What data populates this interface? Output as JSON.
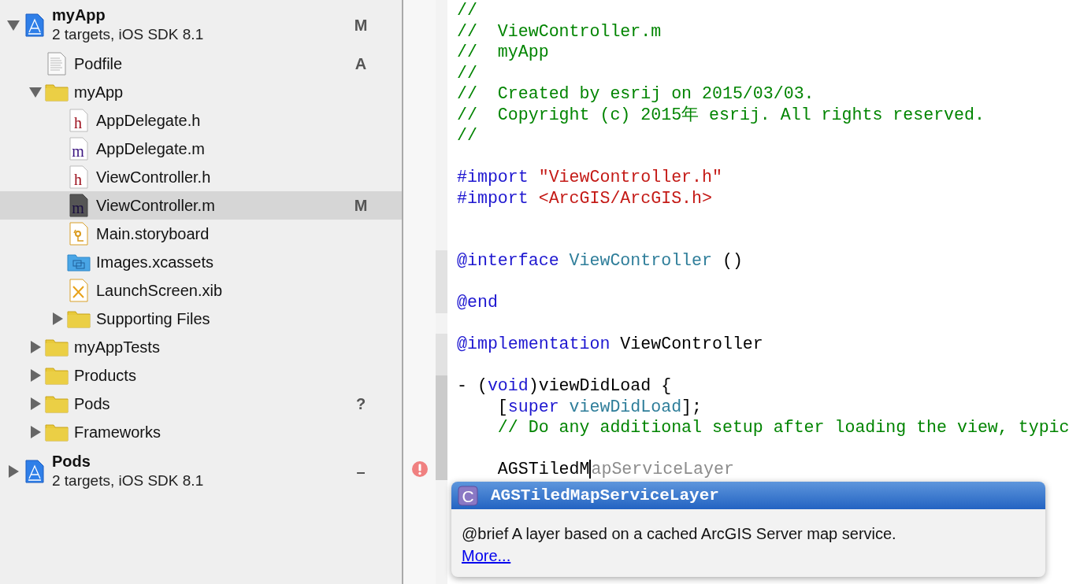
{
  "navigator": {
    "items": [
      {
        "name": "myApp",
        "kind": "project",
        "subtitle": "2 targets, iOS SDK 8.1",
        "badge": "M",
        "expanded": true,
        "selected": false,
        "children": [
          {
            "name": "Podfile",
            "kind": "text",
            "badge": "A",
            "selected": false
          },
          {
            "name": "myApp",
            "kind": "folder",
            "expanded": true,
            "selected": false,
            "children": [
              {
                "name": "AppDelegate.h",
                "kind": "header",
                "glyph": "h",
                "selected": false
              },
              {
                "name": "AppDelegate.m",
                "kind": "source",
                "glyph": "m",
                "selected": false
              },
              {
                "name": "ViewController.h",
                "kind": "header",
                "glyph": "h",
                "selected": false
              },
              {
                "name": "ViewController.m",
                "kind": "source",
                "glyph": "m",
                "badge": "M",
                "selected": true
              },
              {
                "name": "Main.storyboard",
                "kind": "storyboard",
                "selected": false
              },
              {
                "name": "Images.xcassets",
                "kind": "assets",
                "selected": false
              },
              {
                "name": "LaunchScreen.xib",
                "kind": "xib",
                "selected": false
              },
              {
                "name": "Supporting Files",
                "kind": "folder",
                "expanded": false,
                "selected": false
              }
            ]
          },
          {
            "name": "myAppTests",
            "kind": "folder",
            "expanded": false,
            "selected": false
          },
          {
            "name": "Products",
            "kind": "folder",
            "expanded": false,
            "selected": false
          },
          {
            "name": "Pods",
            "kind": "folder",
            "badge": "?",
            "expanded": false,
            "selected": false
          },
          {
            "name": "Frameworks",
            "kind": "folder",
            "expanded": false,
            "selected": false
          }
        ]
      },
      {
        "name": "Pods",
        "kind": "project",
        "subtitle": "2 targets, iOS SDK 8.1",
        "badge": "–",
        "expanded": false,
        "selected": false
      }
    ]
  },
  "editor": {
    "blocks": [
      {
        "kind": "unchanged",
        "lines": [
          {
            "kind": "code",
            "tokens": [
              {
                "kind": "comment",
                "text": "//"
              }
            ]
          },
          {
            "kind": "code",
            "tokens": [
              {
                "kind": "comment",
                "text": "//  ViewController.m"
              }
            ]
          },
          {
            "kind": "code",
            "tokens": [
              {
                "kind": "comment",
                "text": "//  myApp"
              }
            ]
          },
          {
            "kind": "code",
            "tokens": [
              {
                "kind": "comment",
                "text": "//"
              }
            ]
          },
          {
            "kind": "code",
            "tokens": [
              {
                "kind": "comment",
                "text": "//  Created by esrij on 2015/03/03."
              }
            ]
          },
          {
            "kind": "code",
            "tokens": [
              {
                "kind": "comment",
                "text": "//  Copyright (c) 2015年 esrij. All rights reserved."
              }
            ]
          },
          {
            "kind": "code",
            "tokens": [
              {
                "kind": "comment",
                "text": "//"
              }
            ]
          },
          {
            "kind": "blank"
          },
          {
            "kind": "code",
            "tokens": [
              {
                "kind": "keyword",
                "text": "#import "
              },
              {
                "kind": "string",
                "text": "\"ViewController.h\""
              }
            ]
          },
          {
            "kind": "code",
            "tokens": [
              {
                "kind": "keyword",
                "text": "#import "
              },
              {
                "kind": "string",
                "text": "<ArcGIS/ArcGIS.h>"
              }
            ]
          },
          {
            "kind": "blank"
          },
          {
            "kind": "blank"
          }
        ]
      },
      {
        "kind": "added",
        "lines": [
          {
            "kind": "code",
            "tokens": [
              {
                "kind": "keyword",
                "text": "@interface "
              },
              {
                "kind": "type",
                "text": "ViewController"
              },
              {
                "kind": "plain",
                "text": " ()"
              }
            ]
          },
          {
            "kind": "blank"
          },
          {
            "kind": "code",
            "tokens": [
              {
                "kind": "keyword",
                "text": "@end"
              }
            ]
          }
        ]
      },
      {
        "kind": "unchanged",
        "lines": [
          {
            "kind": "blank"
          }
        ]
      },
      {
        "kind": "added",
        "lines": [
          {
            "kind": "code",
            "tokens": [
              {
                "kind": "keyword",
                "text": "@implementation"
              },
              {
                "kind": "plain",
                "text": " ViewController"
              }
            ]
          },
          {
            "kind": "blank"
          }
        ]
      },
      {
        "kind": "modified",
        "lines": [
          {
            "kind": "code",
            "tokens": [
              {
                "kind": "plain",
                "text": "- ("
              },
              {
                "kind": "keyword",
                "text": "void"
              },
              {
                "kind": "plain",
                "text": ")viewDidLoad {"
              }
            ]
          },
          {
            "kind": "code",
            "tokens": [
              {
                "kind": "plain",
                "text": "    ["
              },
              {
                "kind": "keyword",
                "text": "super"
              },
              {
                "kind": "type",
                "text": " viewDidLoad"
              },
              {
                "kind": "plain",
                "text": "];"
              }
            ]
          },
          {
            "kind": "code",
            "tokens": [
              {
                "kind": "comment",
                "text": "    // Do any additional setup after loading the view, typic"
              }
            ]
          },
          {
            "kind": "blank"
          },
          {
            "kind": "code",
            "error": true,
            "tokens": [
              {
                "kind": "plain",
                "text": "    AGSTiledM"
              },
              {
                "kind": "ghost",
                "text": "apServiceLayer"
              }
            ]
          }
        ]
      }
    ]
  },
  "completion": {
    "icon_letter": "C",
    "title": "AGSTiledMapServiceLayer",
    "description": "@brief A layer based on a cached ArcGIS Server map service.",
    "link": "More..."
  }
}
